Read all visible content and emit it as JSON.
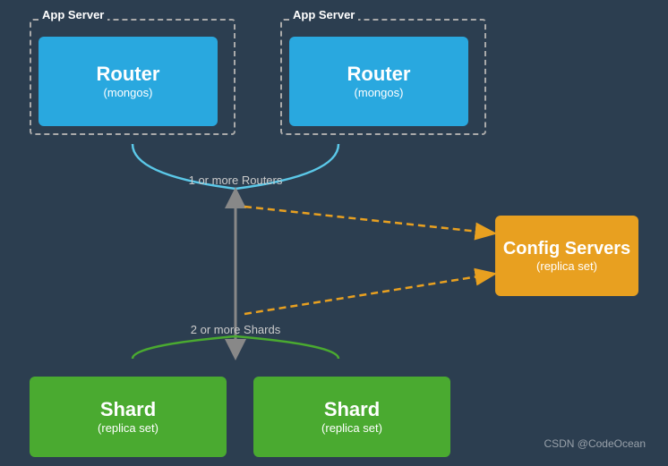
{
  "appServer1": {
    "label": "App Server",
    "router": {
      "title": "Router",
      "subtitle": "(mongos)"
    }
  },
  "appServer2": {
    "label": "App Server",
    "router": {
      "title": "Router",
      "subtitle": "(mongos)"
    }
  },
  "configServers": {
    "title": "Config Servers",
    "subtitle": "(replica set)"
  },
  "shard1": {
    "title": "Shard",
    "subtitle": "(replica set)"
  },
  "shard2": {
    "title": "Shard",
    "subtitle": "(replica set)"
  },
  "labels": {
    "routersLabel": "1 or more Routers",
    "shardsLabel": "2 or more Shards"
  },
  "watermark": {
    "text": "CSDN @CodeOcean"
  },
  "colors": {
    "router": "#29a8df",
    "config": "#e8a020",
    "shard": "#4aaa30",
    "background": "#2c3e50"
  }
}
